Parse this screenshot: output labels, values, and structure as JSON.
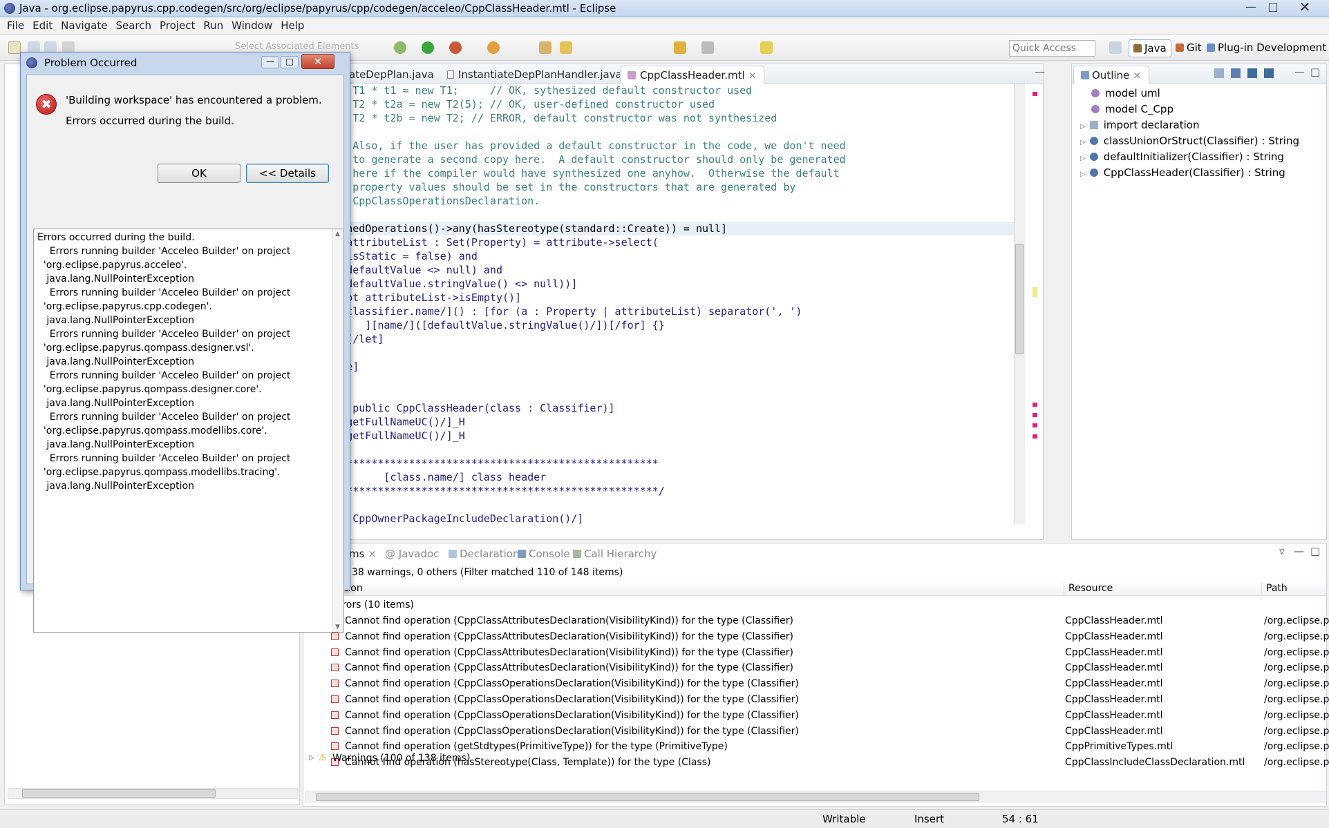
{
  "window": {
    "title": "Java - org.eclipse.papyrus.cpp.codegen/src/org/eclipse/papyrus/cpp/codegen/acceleo/CppClassHeader.mtl - Eclipse"
  },
  "menu": [
    "File",
    "Edit",
    "Navigate",
    "Search",
    "Project",
    "Run",
    "Window",
    "Help"
  ],
  "toolbar": {
    "select_elements": "Select Associated Elements",
    "quick_access_placeholder": "Quick Access",
    "perspectives": {
      "java": "Java",
      "git": "Git",
      "plugin": "Plug-in Development"
    }
  },
  "editor": {
    "tabs": [
      "ateDepPlan.java",
      "InstantiateDepPlanHandler.java",
      "CppClassHeader.mtl"
    ],
    "lines": [
      "        T1 * t1 = new T1;     // OK, sythesized default constructor used",
      "        T2 * t2a = new T2(5); // OK, user-defined constructor used",
      "        T2 * t2b = new T2; // ERROR, default constructor was not synthesized",
      "",
      "        Also, if the user has provided a default constructor in the code, we don't need",
      "        to generate a second copy here.  A default constructor should only be generated",
      "        here if the compiler would have synthesized one anyhow.  Otherwise the default",
      "        property values should be set in the constructors that are generated by",
      "        CppClassOperationsDeclaration.",
      "",
      "f getOwnedOperations()->any(hasStereotype(standard::Create)) = null]",
      "  [let attributeList : Set(Property) = attribute->select(",
      "      (isStatic = false) and",
      "      (defaultValue <> null) and",
      "      (defaultValue.stringValue() <> null))]",
      "  [if not attributeList->isEmpty()]",
      "      [classifier.name/]() : [for (a : Property | attributeList) separator(', ')",
      "          ][name/]([defaultValue.stringValue()/])[/for] {}",
      "  [/if][/let]",
      "if]",
      "template]",
      "",
      "",
      "emplate public CppClassHeader(class : Classifier)]",
      "fndef [getFullNameUC()/]_H",
      "efine [getFullNameUC()/]_H",
      "",
      "*********************************************************",
      "             [class.name/] class header",
      "*********************************************************/",
      "",
      "package.CppOwnerPackageIncludeDeclaration()/]"
    ]
  },
  "outline": {
    "tab": "Outline",
    "items": [
      "model uml",
      "model C_Cpp",
      "import declaration",
      "classUnionOrStruct(Classifier) : String",
      "defaultInitializer(Classifier) : String",
      "CppClassHeader(Classifier) : String"
    ]
  },
  "bottom": {
    "tabs": [
      "ms",
      "Javadoc",
      "Declaration",
      "Console",
      "Call Hierarchy"
    ],
    "summary": "38 warnings, 0 others (Filter matched 110 of 148 items)",
    "columns": [
      "Description",
      "Resource",
      "Path"
    ],
    "errors_group": "Errors (10 items)",
    "warnings_group": "Warnings (100 of 138 items)",
    "rows": [
      {
        "desc": "Cannot find operation (CppClassAttributesDeclaration(VisibilityKind)) for the type (Classifier)",
        "resource": "CppClassHeader.mtl",
        "path": "/org.eclipse.p"
      },
      {
        "desc": "Cannot find operation (CppClassAttributesDeclaration(VisibilityKind)) for the type (Classifier)",
        "resource": "CppClassHeader.mtl",
        "path": "/org.eclipse.p"
      },
      {
        "desc": "Cannot find operation (CppClassAttributesDeclaration(VisibilityKind)) for the type (Classifier)",
        "resource": "CppClassHeader.mtl",
        "path": "/org.eclipse.p"
      },
      {
        "desc": "Cannot find operation (CppClassAttributesDeclaration(VisibilityKind)) for the type (Classifier)",
        "resource": "CppClassHeader.mtl",
        "path": "/org.eclipse.p"
      },
      {
        "desc": "Cannot find operation (CppClassOperationsDeclaration(VisibilityKind)) for the type (Classifier)",
        "resource": "CppClassHeader.mtl",
        "path": "/org.eclipse.p"
      },
      {
        "desc": "Cannot find operation (CppClassOperationsDeclaration(VisibilityKind)) for the type (Classifier)",
        "resource": "CppClassHeader.mtl",
        "path": "/org.eclipse.p"
      },
      {
        "desc": "Cannot find operation (CppClassOperationsDeclaration(VisibilityKind)) for the type (Classifier)",
        "resource": "CppClassHeader.mtl",
        "path": "/org.eclipse.p"
      },
      {
        "desc": "Cannot find operation (CppClassOperationsDeclaration(VisibilityKind)) for the type (Classifier)",
        "resource": "CppClassHeader.mtl",
        "path": "/org.eclipse.p"
      },
      {
        "desc": "Cannot find operation (getStdtypes(PrimitiveType)) for the type (PrimitiveType)",
        "resource": "CppPrimitiveTypes.mtl",
        "path": "/org.eclipse.p"
      },
      {
        "desc": "Cannot find operation (hasStereotype(Class, Template)) for the type (Class)",
        "resource": "CppClassIncludeClassDeclaration.mtl",
        "path": "/org.eclipse.p"
      }
    ]
  },
  "dialog": {
    "title": "Problem Occurred",
    "message": "'Building workspace' has encountered a problem.",
    "sub": "Errors occurred during the build.",
    "ok": "OK",
    "details_button": "<< Details",
    "details": [
      "Errors occurred during the build.",
      "    Errors running builder 'Acceleo Builder' on project",
      "  'org.eclipse.papyrus.acceleo'.",
      "   java.lang.NullPointerException",
      "    Errors running builder 'Acceleo Builder' on project",
      "  'org.eclipse.papyrus.cpp.codegen'.",
      "   java.lang.NullPointerException",
      "    Errors running builder 'Acceleo Builder' on project",
      "  'org.eclipse.papyrus.qompass.designer.vsl'.",
      "   java.lang.NullPointerException",
      "    Errors running builder 'Acceleo Builder' on project",
      "  'org.eclipse.papyrus.qompass.designer.core'.",
      "   java.lang.NullPointerException",
      "    Errors running builder 'Acceleo Builder' on project",
      "  'org.eclipse.papyrus.qompass.modellibs.core'.",
      "   java.lang.NullPointerException",
      "    Errors running builder 'Acceleo Builder' on project",
      "  'org.eclipse.papyrus.qompass.modellibs.tracing'.",
      "   java.lang.NullPointerException"
    ]
  },
  "status": {
    "writable": "Writable",
    "insert": "Insert",
    "position": "54 : 61"
  }
}
